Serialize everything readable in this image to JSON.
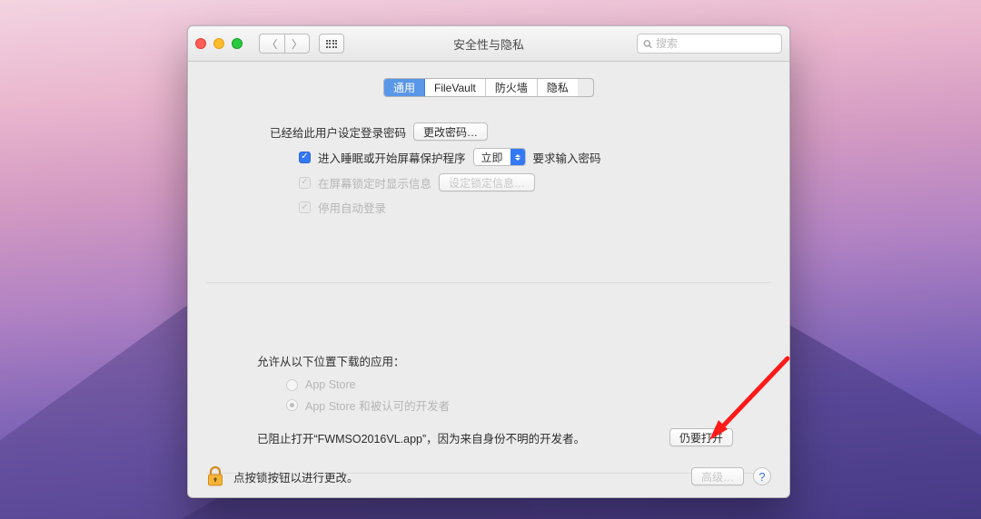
{
  "window": {
    "title": "安全性与隐私",
    "search_placeholder": "搜索"
  },
  "tabs": [
    "通用",
    "FileVault",
    "防火墙",
    "隐私"
  ],
  "tab_active_index": 0,
  "general": {
    "password_set_label": "已经给此用户设定登录密码",
    "change_password_btn": "更改密码…",
    "sleep_checkbox_label": "进入睡眠或开始屏幕保护程序",
    "sleep_select_value": "立即",
    "sleep_after_label": "要求输入密码",
    "lock_msg_checkbox_label": "在屏幕锁定时显示信息",
    "lock_msg_btn": "设定锁定信息…",
    "disable_autologin_label": "停用自动登录"
  },
  "allow": {
    "title": "允许从以下位置下载的应用：",
    "opt1": "App Store",
    "opt2": "App Store 和被认可的开发者",
    "blocked_text": "已阻止打开“FWMSO2016VL.app”，因为来自身份不明的开发者。",
    "open_anyway_btn": "仍要打开"
  },
  "footer": {
    "lock_hint": "点按锁按钮以进行更改。",
    "advanced_btn": "高级…"
  }
}
